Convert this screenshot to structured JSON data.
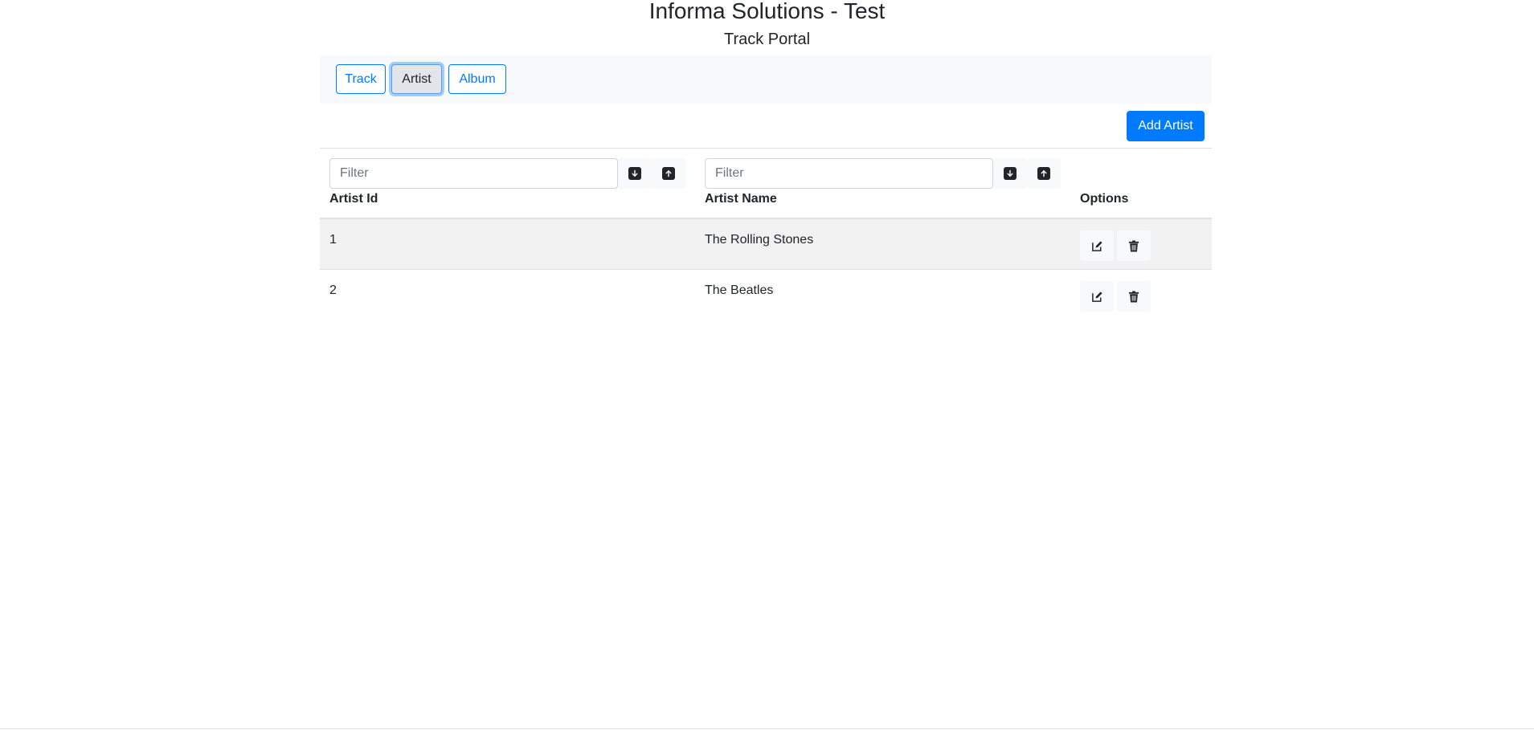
{
  "header": {
    "title": "Informa Solutions - Test",
    "subtitle": "Track Portal"
  },
  "nav": {
    "tabs": [
      {
        "label": "Track"
      },
      {
        "label": "Artist"
      },
      {
        "label": "Album"
      }
    ],
    "active_tab": "Artist"
  },
  "toolbar": {
    "add_label": "Add Artist"
  },
  "table": {
    "columns": [
      {
        "label": "Artist Id"
      },
      {
        "label": "Artist Name"
      },
      {
        "label": "Options"
      }
    ],
    "filter_placeholder": "Filter",
    "rows": [
      {
        "id": "1",
        "name": "The Rolling Stones"
      },
      {
        "id": "2",
        "name": "The Beatles"
      }
    ]
  },
  "icons": {
    "sort_desc": "arrow-down-icon",
    "sort_asc": "arrow-up-icon",
    "edit": "pencil-square-icon",
    "delete": "trash-icon"
  },
  "colors": {
    "primary": "#007bff",
    "navbar_bg": "#f8f9fa",
    "stripe": "#f2f2f2",
    "text": "#212529"
  }
}
